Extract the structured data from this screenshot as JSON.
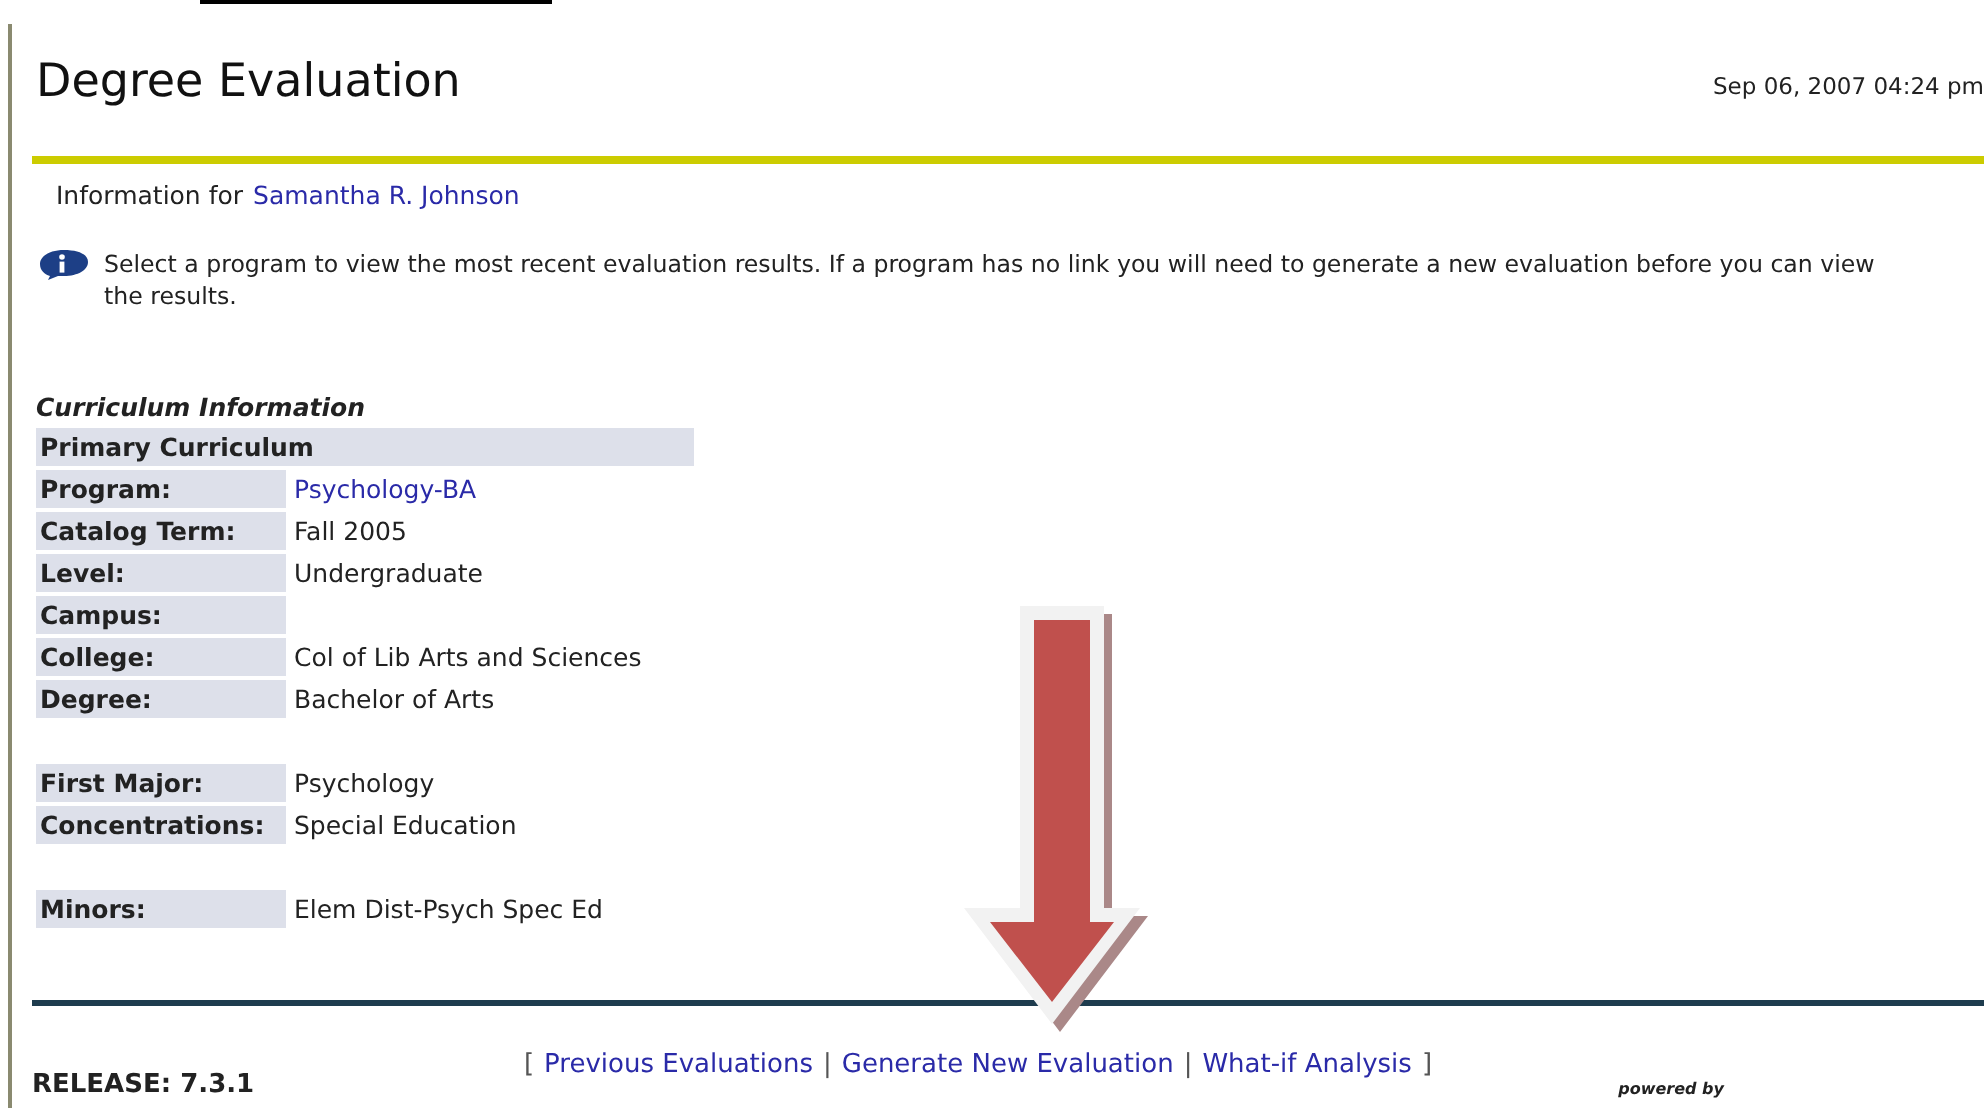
{
  "header": {
    "title": "Degree Evaluation",
    "timestamp": "Sep 06, 2007 04:24 pm"
  },
  "student": {
    "label": "Information for",
    "name": "Samantha R. Johnson"
  },
  "instructions": "Select a program to view the most recent evaluation results. If a program has no link you will need to generate a new evaluation before you can view the results.",
  "curriculum": {
    "heading": "Curriculum Information",
    "section": "Primary Curriculum",
    "groups": [
      [
        {
          "label": "Program:",
          "value": "Psychology-BA",
          "kind": "link"
        },
        {
          "label": "Catalog Term:",
          "value": "Fall 2005",
          "kind": "text"
        },
        {
          "label": "Level:",
          "value": "Undergraduate",
          "kind": "text"
        },
        {
          "label": "Campus:",
          "kind": "text"
        },
        {
          "label": "College:",
          "value": "Col of Lib Arts and Sciences",
          "kind": "text"
        },
        {
          "label": "Degree:",
          "value": "Bachelor of Arts",
          "kind": "text"
        }
      ],
      [
        {
          "label": "First Major:",
          "value": "Psychology",
          "kind": "text"
        },
        {
          "label": "Concentrations:",
          "value": "Special Education",
          "kind": "text"
        }
      ],
      [
        {
          "label": "Minors:",
          "value": "Elem Dist-Psych Spec Ed",
          "kind": "text"
        }
      ]
    ]
  },
  "footer": {
    "nav": [
      {
        "kind": "bracket",
        "text": "["
      },
      {
        "kind": "link",
        "text": "Previous Evaluations"
      },
      {
        "kind": "separator",
        "text": "|"
      },
      {
        "kind": "link",
        "text": "Generate New Evaluation"
      },
      {
        "kind": "separator",
        "text": "|"
      },
      {
        "kind": "link",
        "text": "What-if Analysis"
      },
      {
        "kind": "bracket",
        "text": "]"
      }
    ],
    "release": "RELEASE: 7.3.1",
    "powered_by": "powered by"
  }
}
